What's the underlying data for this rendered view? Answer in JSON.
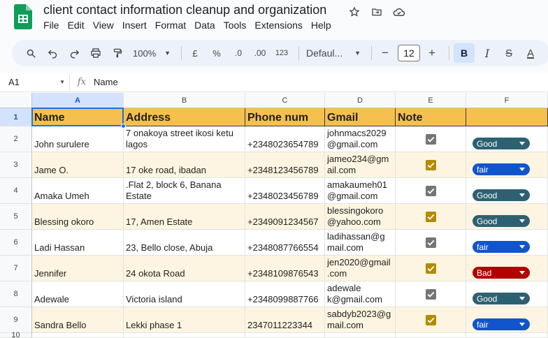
{
  "app": {
    "title": "client contact information cleanup and organization",
    "menu": [
      "File",
      "Edit",
      "View",
      "Insert",
      "Format",
      "Data",
      "Tools",
      "Extensions",
      "Help"
    ],
    "icons": [
      "star-icon",
      "move-to-folder-icon",
      "cloud-status-icon"
    ]
  },
  "toolbar": {
    "zoom": "100%",
    "currency": "£",
    "percent": "%",
    "dec_decrease": ".0",
    "dec_increase": ".00",
    "number_format": "123",
    "font": "Defaul...",
    "font_size": "12",
    "minus": "−",
    "plus": "+",
    "bold": "B",
    "italic": "I",
    "strike": "S",
    "text_color": "A"
  },
  "formula_bar": {
    "cell_ref": "A1",
    "fx": "fx",
    "value": "Name"
  },
  "columns": [
    "A",
    "B",
    "C",
    "D",
    "E",
    "F"
  ],
  "rows": [
    "1",
    "2",
    "3",
    "4",
    "5",
    "6",
    "7",
    "8",
    "9",
    "10"
  ],
  "header_row": [
    "Name",
    "Address",
    "Phone num",
    "Gmail",
    "Note",
    ""
  ],
  "data": [
    {
      "name": "John surulere",
      "address": "7 onakoya street ikosi ketu lagos",
      "phone": "+2348023654789",
      "gmail": "johnmacs2029@gmail.com",
      "note": true,
      "status": "Good"
    },
    {
      "name": "Jame O.",
      "address": "17 oke road, ibadan",
      "phone": "+2348123456789",
      "gmail": "jameo234@gmail.com",
      "note": true,
      "status": "fair"
    },
    {
      "name": "Amaka Umeh",
      "address": ".Flat 2, block 6, Banana Estate",
      "phone": "+2348023456789",
      "gmail": "amakaumeh01@gmail.com",
      "note": true,
      "status": "Good"
    },
    {
      "name": "Blessing okoro",
      "address": "17, Amen Estate",
      "phone": "+2349091234567",
      "gmail": "blessingokoro@yahoo.com",
      "note": true,
      "status": "Good"
    },
    {
      "name": "Ladi Hassan",
      "address": "23, Bello close, Abuja",
      "phone": "+2348087766554",
      "gmail": "ladihassan@gmail.com",
      "note": true,
      "status": "fair"
    },
    {
      "name": "Jennifer",
      "address": "24 okota Road",
      "phone": "+2348109876543",
      "gmail": "jen2020@gmail.com",
      "note": true,
      "status": "Bad"
    },
    {
      "name": "Adewale",
      "address": "Victoria island",
      "phone": "+2348099887766",
      "gmail": "adewalek@gmail.com",
      "note": true,
      "status": "Good"
    },
    {
      "name": "Sandra Bello",
      "address": "Lekki phase 1",
      "phone": "2347011223344",
      "gmail": "sabdyb2023@gmail.com",
      "note": true,
      "status": "fair"
    }
  ],
  "gmail_display": [
    [
      "johnmacs2029",
      "@gmail.com"
    ],
    [
      "jameo234@gm",
      "ail.com"
    ],
    [
      "amakaumeh01",
      "@gmail.com"
    ],
    [
      "blessingokoro",
      "@yahoo.com"
    ],
    [
      "ladihassan@g",
      "mail.com"
    ],
    [
      "jen2020@gmail",
      ".com"
    ],
    [
      "adewale",
      "k@gmail.com"
    ],
    [
      "sabdyb2023@g",
      "mail.com"
    ]
  ],
  "address_display": [
    [
      "7 onakoya street ikosi ketu",
      "lagos"
    ],
    [
      "",
      "17 oke road, ibadan"
    ],
    [
      ".Flat 2, block 6, Banana",
      "Estate"
    ],
    [
      "",
      "17, Amen Estate"
    ],
    [
      "",
      "23, Bello close, Abuja"
    ],
    [
      "",
      "24 okota Road"
    ],
    [
      "",
      "Victoria island"
    ],
    [
      "",
      "Lekki phase 1"
    ]
  ],
  "colors": {
    "header_fill": "#f6c04f",
    "band_fill": "#fdf5e1",
    "good_chip": "#2d6172",
    "fair_chip": "#1155cc",
    "bad_chip": "#b10202",
    "check_gray": "#757575",
    "check_gold": "#b38a00"
  }
}
